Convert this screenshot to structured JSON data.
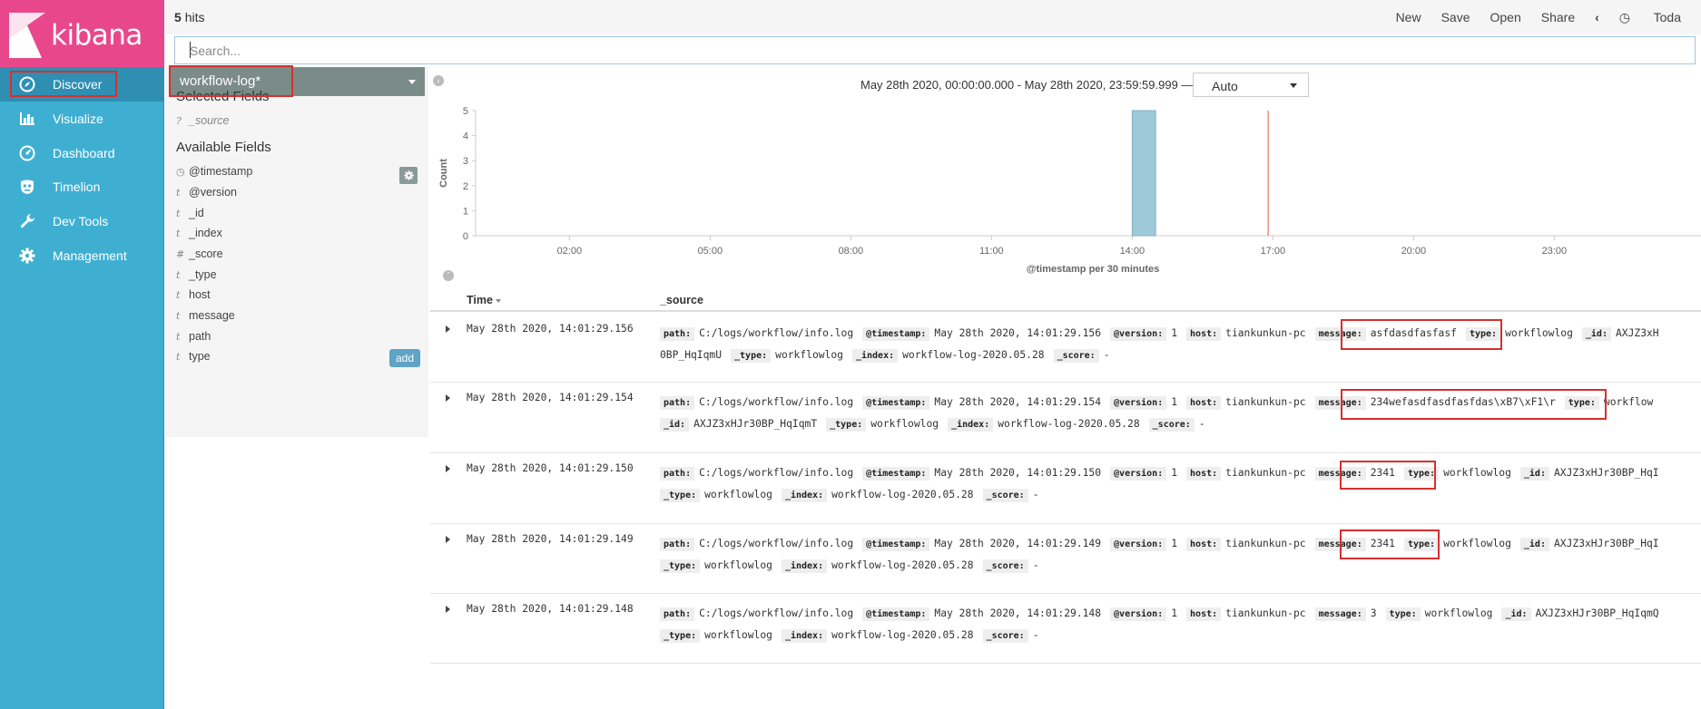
{
  "app": {
    "name": "kibana"
  },
  "nav": {
    "items": [
      {
        "label": "Discover",
        "icon": "compass-icon",
        "active": true
      },
      {
        "label": "Visualize",
        "icon": "bar-chart-icon",
        "active": false
      },
      {
        "label": "Dashboard",
        "icon": "dashboard-gauge-icon",
        "active": false
      },
      {
        "label": "Timelion",
        "icon": "timelion-mask-icon",
        "active": false
      },
      {
        "label": "Dev Tools",
        "icon": "wrench-icon",
        "active": false
      },
      {
        "label": "Management",
        "icon": "gear-icon",
        "active": false
      }
    ]
  },
  "topbar": {
    "hits_count": "5",
    "hits_label": "hits",
    "menu": {
      "new": "New",
      "save": "Save",
      "open": "Open",
      "share": "Share",
      "back": "‹",
      "today": "Toda"
    }
  },
  "search": {
    "placeholder": "Search..."
  },
  "sidebar": {
    "index_pattern": "workflow-log*",
    "selected_fields_title": "Selected Fields",
    "selected_fields": [
      {
        "type": "?",
        "name": "_source"
      }
    ],
    "available_fields_title": "Available Fields",
    "available_fields": [
      {
        "type": "clock",
        "name": "@timestamp"
      },
      {
        "type": "t",
        "name": "@version"
      },
      {
        "type": "t",
        "name": "_id"
      },
      {
        "type": "t",
        "name": "_index"
      },
      {
        "type": "#",
        "name": "_score"
      },
      {
        "type": "t",
        "name": "_type"
      },
      {
        "type": "t",
        "name": "host"
      },
      {
        "type": "t",
        "name": "message"
      },
      {
        "type": "t",
        "name": "path"
      },
      {
        "type": "t",
        "name": "type"
      }
    ],
    "add_label": "add"
  },
  "timepicker": {
    "range": "May 28th 2020, 00:00:00.000 - May 28th 2020, 23:59:59.999 —",
    "interval": "Auto"
  },
  "chart_data": {
    "type": "bar",
    "ylabel": "Count",
    "xlabel": "@timestamp per 30 minutes",
    "ylim": [
      0,
      5
    ],
    "yticks": [
      "0",
      "1",
      "2",
      "3",
      "4",
      "5"
    ],
    "xticks": [
      "02:00",
      "05:00",
      "08:00",
      "11:00",
      "14:00",
      "17:00",
      "20:00",
      "23:00"
    ],
    "xrange_hours": [
      0,
      24
    ],
    "bars": [
      {
        "start_hour": 14.0,
        "end_hour": 14.5,
        "value": 5
      }
    ],
    "now_marker_hour": 16.9,
    "bar_color": "#9ec9d8",
    "marker_color": "#f08a80"
  },
  "table": {
    "headers": {
      "time": "Time",
      "source": "_source"
    },
    "rows": [
      {
        "time": "May 28th 2020, 14:01:29.156",
        "lines": [
          [
            [
              "path:",
              "C:/logs/workflow/info.log"
            ],
            [
              "@timestamp:",
              "May 28th 2020, 14:01:29.156"
            ],
            [
              "@version:",
              "1"
            ],
            [
              "host:",
              "tiankunkun-pc"
            ],
            [
              "message:",
              "asfdasdfasfasf"
            ],
            [
              "type:",
              "workflowlog"
            ],
            [
              "_id:",
              "AXJZ3xH"
            ]
          ],
          [
            [
              "",
              "0BP_HqIqmU"
            ],
            [
              "_type:",
              "workflowlog"
            ],
            [
              "_index:",
              "workflow-log-2020.05.28"
            ],
            [
              "_score:",
              "-"
            ]
          ]
        ]
      },
      {
        "time": "May 28th 2020, 14:01:29.154",
        "lines": [
          [
            [
              "path:",
              "C:/logs/workflow/info.log"
            ],
            [
              "@timestamp:",
              "May 28th 2020, 14:01:29.154"
            ],
            [
              "@version:",
              "1"
            ],
            [
              "host:",
              "tiankunkun-pc"
            ],
            [
              "message:",
              "234wefasdfasdfasfdas\\xB7\\xF1\\r"
            ],
            [
              "type:",
              "workflow"
            ]
          ],
          [
            [
              "_id:",
              "AXJZ3xHJr30BP_HqIqmT"
            ],
            [
              "_type:",
              "workflowlog"
            ],
            [
              "_index:",
              "workflow-log-2020.05.28"
            ],
            [
              "_score:",
              "-"
            ]
          ]
        ]
      },
      {
        "time": "May 28th 2020, 14:01:29.150",
        "lines": [
          [
            [
              "path:",
              "C:/logs/workflow/info.log"
            ],
            [
              "@timestamp:",
              "May 28th 2020, 14:01:29.150"
            ],
            [
              "@version:",
              "1"
            ],
            [
              "host:",
              "tiankunkun-pc"
            ],
            [
              "message:",
              "2341"
            ],
            [
              "type:",
              "workflowlog"
            ],
            [
              "_id:",
              "AXJZ3xHJr30BP_HqI"
            ]
          ],
          [
            [
              "_type:",
              "workflowlog"
            ],
            [
              "_index:",
              "workflow-log-2020.05.28"
            ],
            [
              "_score:",
              "-"
            ]
          ]
        ]
      },
      {
        "time": "May 28th 2020, 14:01:29.149",
        "lines": [
          [
            [
              "path:",
              "C:/logs/workflow/info.log"
            ],
            [
              "@timestamp:",
              "May 28th 2020, 14:01:29.149"
            ],
            [
              "@version:",
              "1"
            ],
            [
              "host:",
              "tiankunkun-pc"
            ],
            [
              "message:",
              "2341"
            ],
            [
              "type:",
              "workflowlog"
            ],
            [
              "_id:",
              "AXJZ3xHJr30BP_HqI"
            ]
          ],
          [
            [
              "_type:",
              "workflowlog"
            ],
            [
              "_index:",
              "workflow-log-2020.05.28"
            ],
            [
              "_score:",
              "-"
            ]
          ]
        ]
      },
      {
        "time": "May 28th 2020, 14:01:29.148",
        "lines": [
          [
            [
              "path:",
              "C:/logs/workflow/info.log"
            ],
            [
              "@timestamp:",
              "May 28th 2020, 14:01:29.148"
            ],
            [
              "@version:",
              "1"
            ],
            [
              "host:",
              "tiankunkun-pc"
            ],
            [
              "message:",
              "3"
            ],
            [
              "type:",
              "workflowlog"
            ],
            [
              "_id:",
              "AXJZ3xHJr30BP_HqIqmQ"
            ]
          ],
          [
            [
              "_type:",
              "workflowlog"
            ],
            [
              "_index:",
              "workflow-log-2020.05.28"
            ],
            [
              "_score:",
              "-"
            ]
          ]
        ]
      }
    ]
  }
}
